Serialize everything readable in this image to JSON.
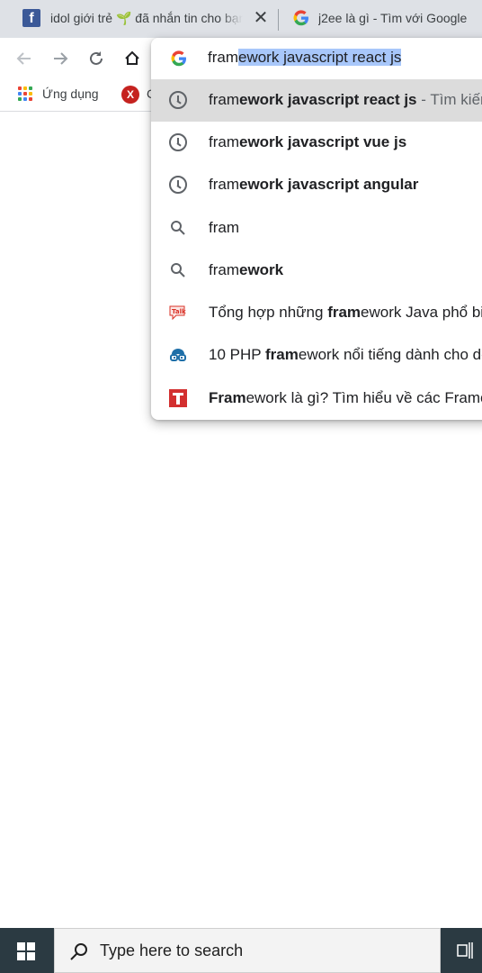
{
  "tabs": [
    {
      "title": "idol giới trẻ 🌱 đã nhắn tin cho bạn",
      "favicon": "facebook-icon",
      "close": "✕"
    },
    {
      "title": "j2ee là gì - Tìm với Google",
      "favicon": "google-icon"
    }
  ],
  "bookmarks": {
    "apps_label": "Ứng dụng",
    "item2_partial": "C"
  },
  "omnibox": {
    "typed": "fram",
    "autocomplete": "ework javascript react js",
    "suggestions": [
      {
        "icon": "history-icon",
        "prefix": "fram",
        "bold": "ework javascript react js",
        "suffix": " - Tìm kiếm với Google",
        "active": true
      },
      {
        "icon": "history-icon",
        "prefix": "fram",
        "bold": "ework javascript vue js",
        "suffix": ""
      },
      {
        "icon": "history-icon",
        "prefix": "fram",
        "bold": "ework javascript angular",
        "suffix": ""
      },
      {
        "icon": "search-icon",
        "prefix": "fram",
        "bold": "",
        "suffix": ""
      },
      {
        "icon": "search-icon",
        "prefix": "fram",
        "bold": "ework",
        "suffix": ""
      },
      {
        "icon": "talk-site-icon",
        "prefix": "Tổng hợp những ",
        "bold": "fram",
        "suffix": "ework Java phổ biến nhất"
      },
      {
        "icon": "php-site-icon",
        "prefix": "10 PHP ",
        "bold": "fram",
        "suffix": "ework nổi tiếng dành cho developer"
      },
      {
        "icon": "t-site-icon",
        "prefix": "",
        "bold": "Fram",
        "suffix": "ework là gì? Tìm hiểu về các Framework"
      }
    ]
  },
  "taskbar": {
    "search_placeholder": "Type here to search"
  },
  "colors": {
    "tabstrip_bg": "#dee1e6",
    "selection": "#a8c7fa",
    "active_row": "#dcdcdc",
    "taskbar_bg": "#2b3a42"
  }
}
